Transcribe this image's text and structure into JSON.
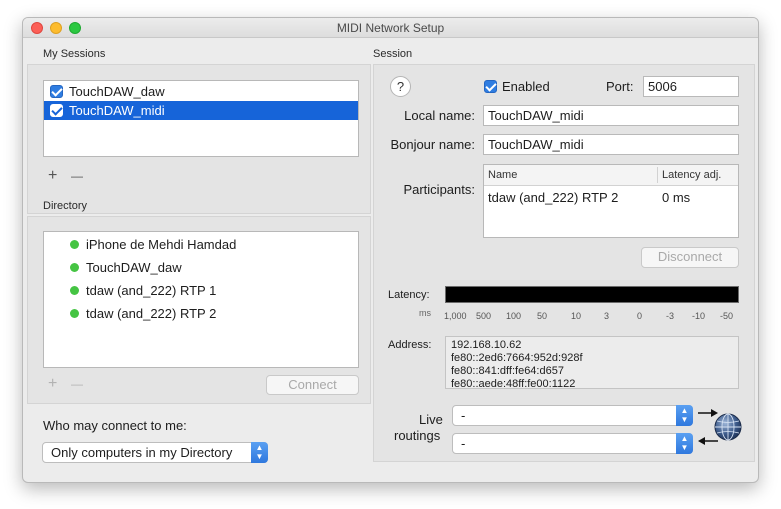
{
  "window": {
    "title": "MIDI Network Setup"
  },
  "my_sessions": {
    "label": "My Sessions",
    "items": [
      {
        "label": "TouchDAW_daw",
        "checked": true,
        "selected": false
      },
      {
        "label": "TouchDAW_midi",
        "checked": true,
        "selected": true
      }
    ],
    "add_symbol": "+",
    "remove_symbol": "—"
  },
  "directory": {
    "label": "Directory",
    "items": [
      {
        "label": "iPhone de Mehdi Hamdad",
        "status_color": "#45c443"
      },
      {
        "label": "TouchDAW_daw",
        "status_color": "#45c443"
      },
      {
        "label": "tdaw (and_222) RTP 1",
        "status_color": "#45c443"
      },
      {
        "label": "tdaw (and_222) RTP 2",
        "status_color": "#45c443"
      }
    ],
    "add_symbol": "+",
    "remove_symbol": "—",
    "connect_label": "Connect"
  },
  "who_may_connect": {
    "label": "Who may connect to me:",
    "selected": "Only computers in my Directory"
  },
  "session": {
    "label": "Session",
    "help_symbol": "?",
    "enabled_label": "Enabled",
    "enabled": true,
    "port_label": "Port:",
    "port_value": "5006",
    "local_name_label": "Local name:",
    "local_name_value": "TouchDAW_midi",
    "bonjour_name_label": "Bonjour name:",
    "bonjour_name_value": "TouchDAW_midi",
    "participants_label": "Participants:",
    "participants_columns": [
      "Name",
      "Latency adj."
    ],
    "participants": [
      {
        "name": "tdaw (and_222) RTP 2",
        "latency": "0 ms"
      }
    ],
    "disconnect_label": "Disconnect",
    "latency_label": "Latency:",
    "latency_unit": "ms",
    "latency_ticks": [
      "1,000",
      "500",
      "100",
      "50",
      "10",
      "3",
      "0",
      "-3",
      "-10",
      "-50"
    ],
    "address_label": "Address:",
    "addresses": [
      "192.168.10.62",
      "fe80::2ed6:7664:952d:928f",
      "fe80::841:dff:fe64:d657",
      "fe80::aede:48ff:fe00:1122"
    ],
    "live_routings_label_1": "Live",
    "live_routings_label_2": "routings",
    "routing_in_value": "-",
    "routing_out_value": "-"
  },
  "colors": {
    "accent": "#1664d9",
    "online_dot": "#45c443",
    "window_bg": "#ececec"
  }
}
